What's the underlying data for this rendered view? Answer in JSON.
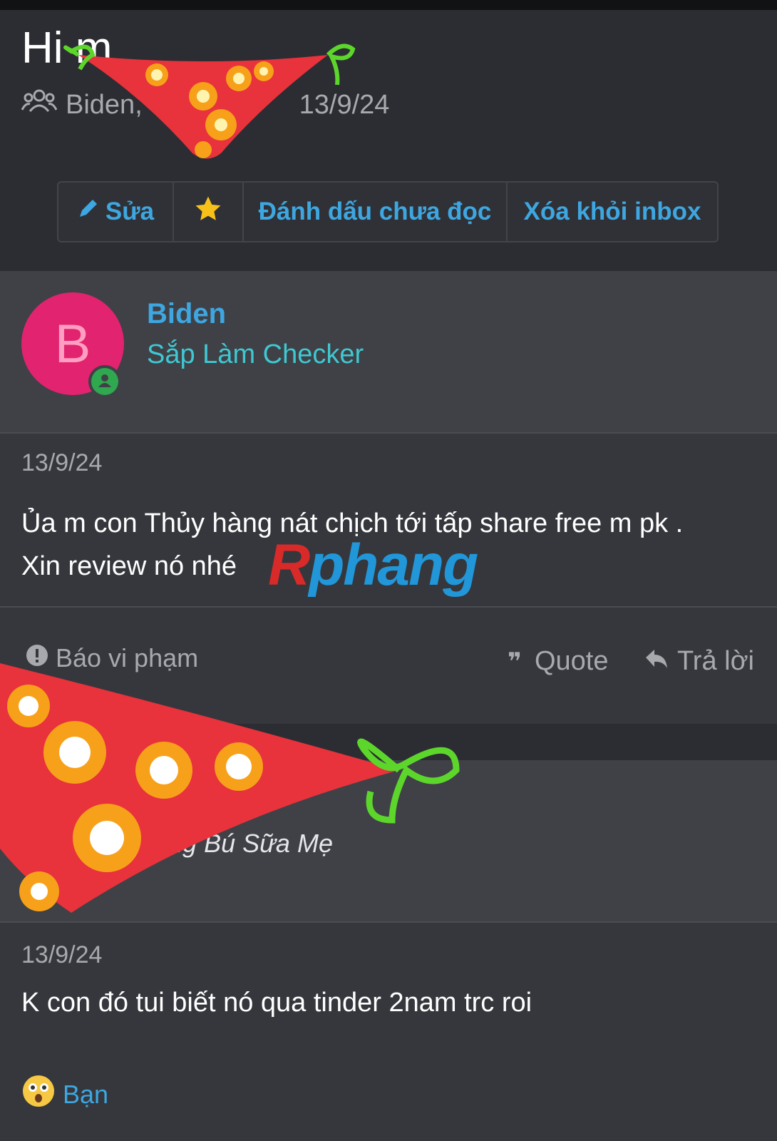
{
  "conversation": {
    "title": "Hi m",
    "participants_prefix": "Biden, S",
    "start_date": "13/9/24"
  },
  "toolbar": {
    "edit_label": "Sửa",
    "mark_unread_label": "Đánh dấu chưa đọc",
    "remove_label": "Xóa khỏi inbox"
  },
  "messages": [
    {
      "avatar_letter": "B",
      "author": "Biden",
      "author_title": "Sắp Làm Checker",
      "date": "13/9/24",
      "text_line1": "Ủa m con Thủy hàng nát chịch tới tấp share free m pk .",
      "text_line2": "Xin review nó nhé",
      "report_label": "Báo vi phạm",
      "quote_label": "Quote",
      "reply_label": "Trả lời"
    },
    {
      "author_title": "ang Bú Sữa Mẹ",
      "date": "13/9/24",
      "text": "K con đó tui biết nó qua tinder 2nam trc roi",
      "reaction_label": "Bạn"
    }
  ],
  "watermark": {
    "r": "R",
    "rest": "phang"
  },
  "colors": {
    "accent": "#3ea6e0",
    "avatar_bg": "#e2236f",
    "online": "#2fa84f",
    "title_teal": "#3fc8d2"
  }
}
